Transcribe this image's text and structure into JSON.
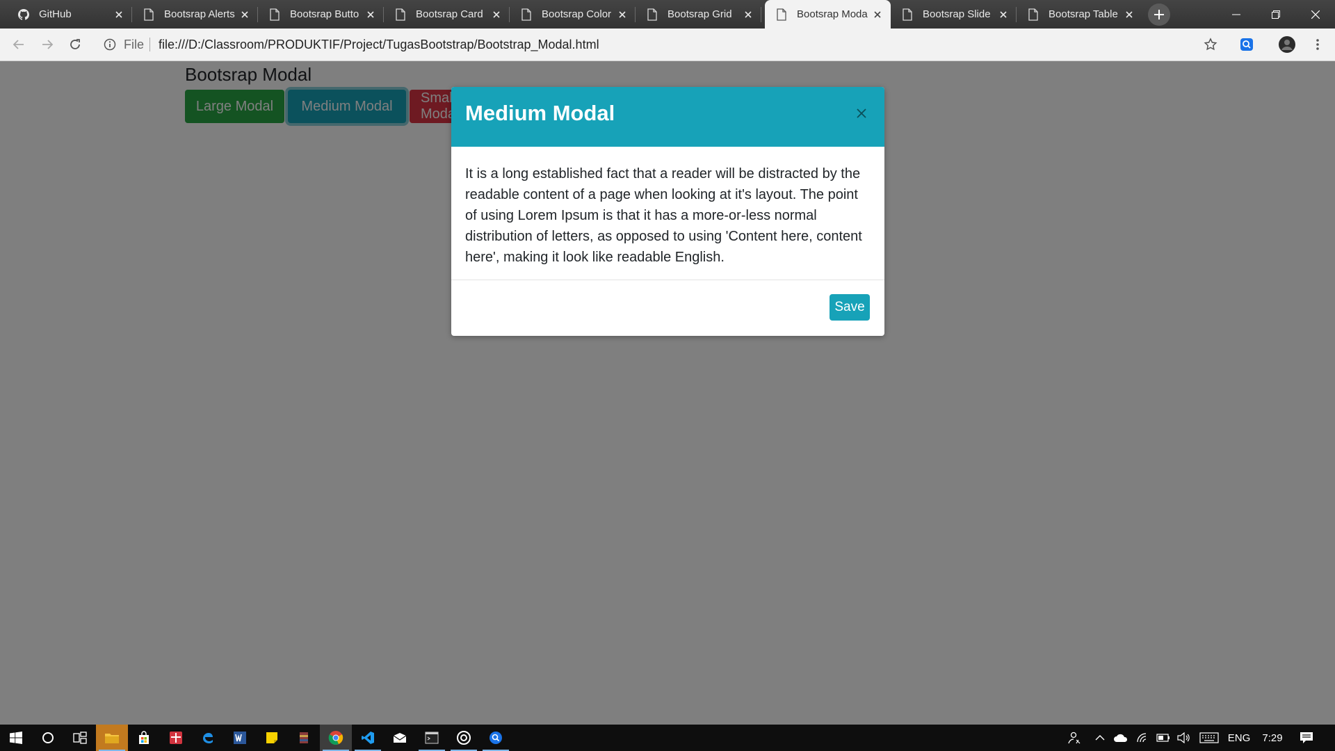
{
  "browser": {
    "tabs": [
      {
        "title": "GitHub",
        "icon": "github-icon",
        "active": false
      },
      {
        "title": "Bootsrap Alerts",
        "icon": "page-icon",
        "active": false
      },
      {
        "title": "Bootsrap Butto",
        "icon": "page-icon",
        "active": false
      },
      {
        "title": "Bootsrap Card",
        "icon": "page-icon",
        "active": false
      },
      {
        "title": "Bootsrap Color",
        "icon": "page-icon",
        "active": false
      },
      {
        "title": "Bootsrap Grid",
        "icon": "page-icon",
        "active": false
      },
      {
        "title": "Bootsrap Moda",
        "icon": "page-icon",
        "active": true
      },
      {
        "title": "Bootsrap Slide",
        "icon": "page-icon",
        "active": false
      },
      {
        "title": "Bootsrap Table",
        "icon": "page-icon",
        "active": false
      }
    ],
    "address": {
      "scheme": "File",
      "url": "file:///D:/Classroom/PRODUKTIF/Project/TugasBootstrap/Bootstrap_Modal.html"
    }
  },
  "page": {
    "title": "Bootsrap Modal",
    "buttons": {
      "large": "Large Modal",
      "medium": "Medium Modal",
      "small": "Small Modal"
    }
  },
  "modal": {
    "title": "Medium Modal",
    "body": "It is a long established fact that a reader will be distracted by the readable content of a page when looking at it's layout. The point of using Lorem Ipsum is that it has a more-or-less normal distribution of letters, as opposed to using 'Content here, content here', making it look like readable English.",
    "save_label": "Save"
  },
  "taskbar": {
    "language": "ENG",
    "time": "7:29"
  },
  "colors": {
    "teal": "#17a2b8",
    "green": "#28a745",
    "red": "#dc3545"
  }
}
